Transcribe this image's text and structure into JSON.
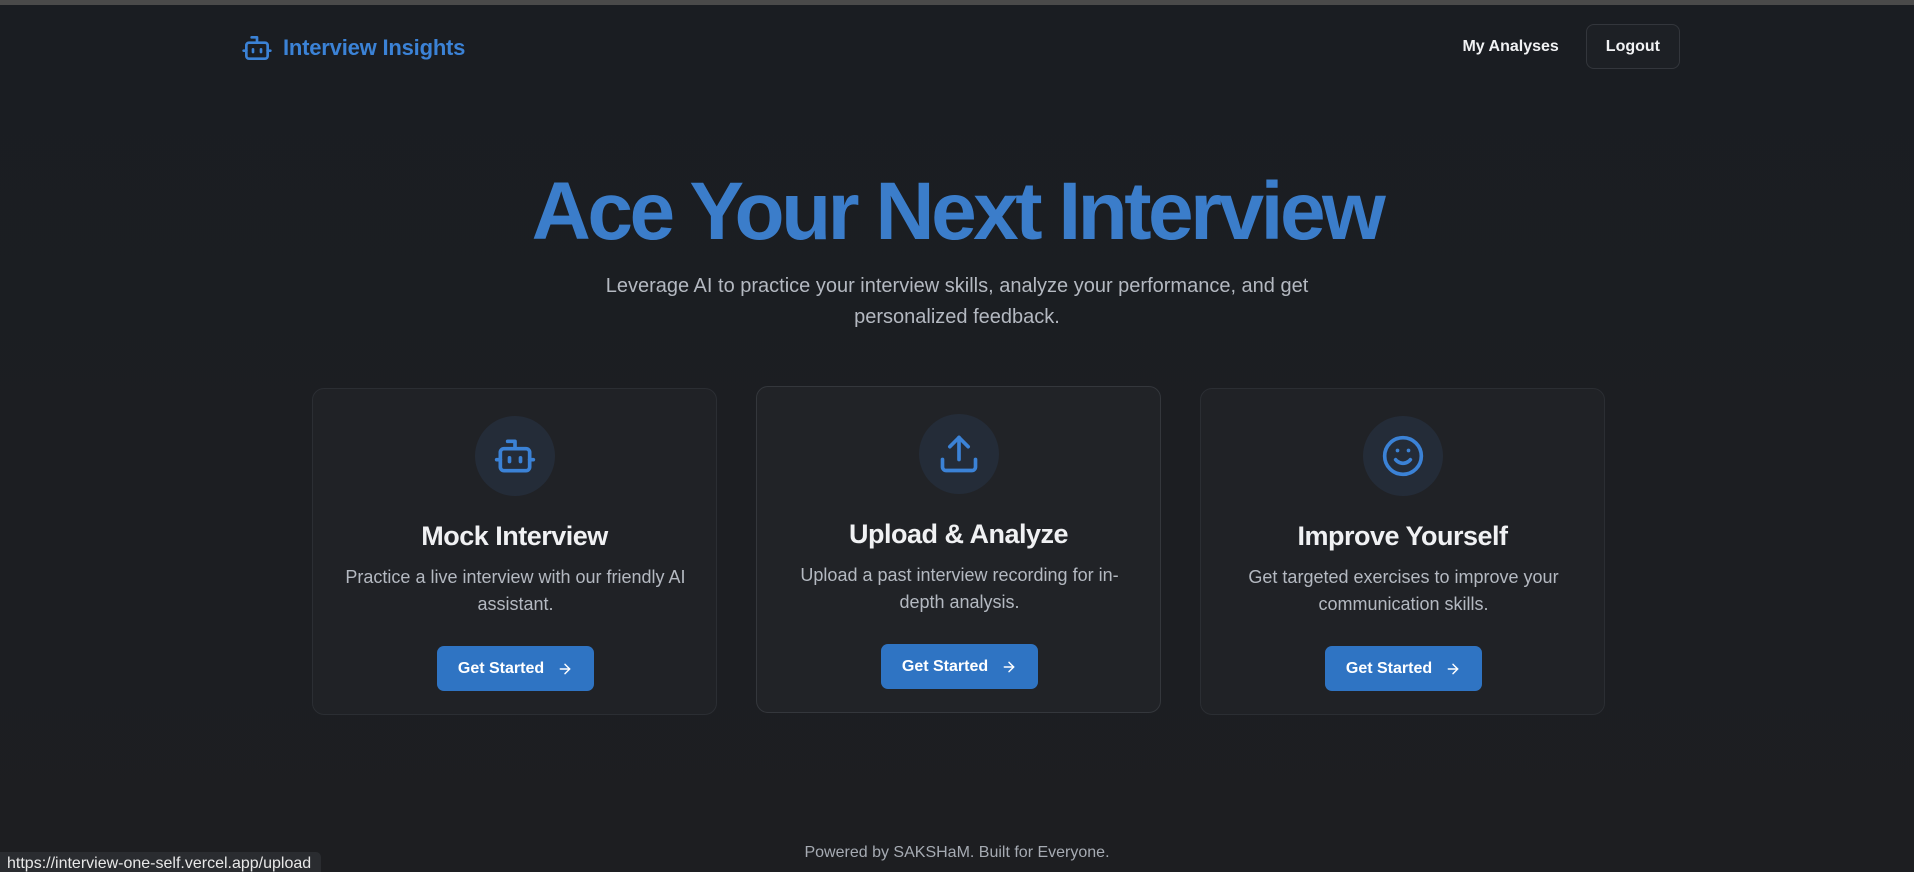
{
  "header": {
    "brand_name": "Interview Insights",
    "brand_icon": "robot-icon",
    "nav": {
      "my_analyses": "My Analyses",
      "logout": "Logout"
    }
  },
  "hero": {
    "title": "Ace Your Next Interview",
    "subtitle": "Leverage AI to practice your interview skills, analyze your performance, and get personalized feedback."
  },
  "cards": [
    {
      "icon": "robot-icon",
      "title": "Mock Interview",
      "description": "Practice a live interview with our friendly AI assistant.",
      "cta": "Get Started"
    },
    {
      "icon": "upload-icon",
      "title": "Upload & Analyze",
      "description": "Upload a past interview recording for in-depth analysis.",
      "cta": "Get Started"
    },
    {
      "icon": "smile-icon",
      "title": "Improve Yourself",
      "description": "Get targeted exercises to improve your communication skills.",
      "cta": "Get Started"
    }
  ],
  "footer": {
    "text": "Powered by SAKSHaM. Built for Everyone."
  },
  "status_bar": {
    "url": "https://interview-one-self.vercel.app/upload"
  },
  "colors": {
    "accent": "#3b82d6",
    "button": "#2f74c3",
    "background": "#1c1e22",
    "card": "#202226"
  }
}
